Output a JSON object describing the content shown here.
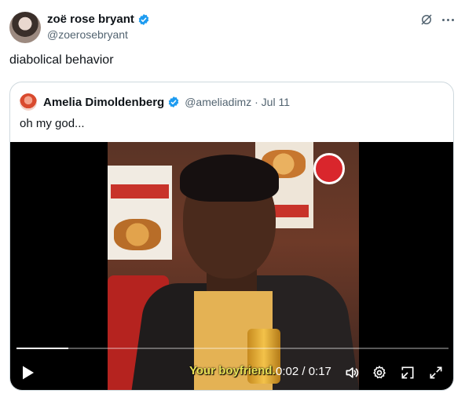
{
  "tweet": {
    "author_name": "zoë rose bryant",
    "author_handle": "@zoerosebryant",
    "text": "diabolical behavior"
  },
  "quoted_tweet": {
    "author_name": "Amelia Dimoldenberg",
    "author_handle": "@ameliadimz · Jul 11",
    "text": "oh my god..."
  },
  "video": {
    "subtitle": "Your boyfriend.",
    "time_display": "0:02 / 0:17",
    "progress_fraction": 0.12
  },
  "icons": {
    "verified": "verified-badge-icon",
    "grok": "grok-icon",
    "more": "more-options-icon",
    "play": "play-icon",
    "volume": "volume-icon",
    "settings": "settings-icon",
    "pip": "picture-in-picture-icon",
    "fullscreen": "fullscreen-icon"
  },
  "colors": {
    "verified": "#1d9bf0",
    "subtitle": "#e9e255",
    "secondary_text": "#536471",
    "border": "#cfd9de"
  }
}
